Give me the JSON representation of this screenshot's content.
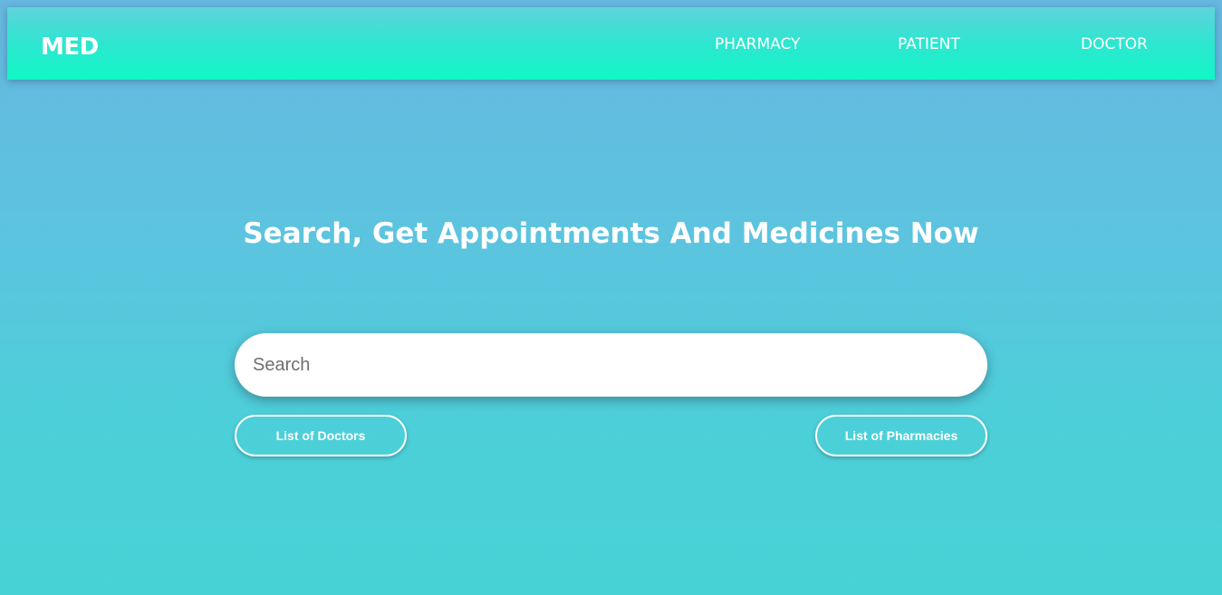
{
  "nav": {
    "logo": "MED",
    "links": [
      {
        "label": "PHARMACY"
      },
      {
        "label": "PATIENT"
      },
      {
        "label": "DOCTOR"
      }
    ]
  },
  "hero": {
    "title": "Search, Get Appointments And Medicines Now"
  },
  "search": {
    "placeholder": "Search",
    "value": ""
  },
  "buttons": {
    "doctors": "List of Doctors",
    "pharmacies": "List of Pharmacies"
  },
  "colors": {
    "page_background_top": "#67b7e0",
    "page_background_bottom": "#47d3d6",
    "navbar_accent": "#10f8c6",
    "text": "#ffffff"
  }
}
